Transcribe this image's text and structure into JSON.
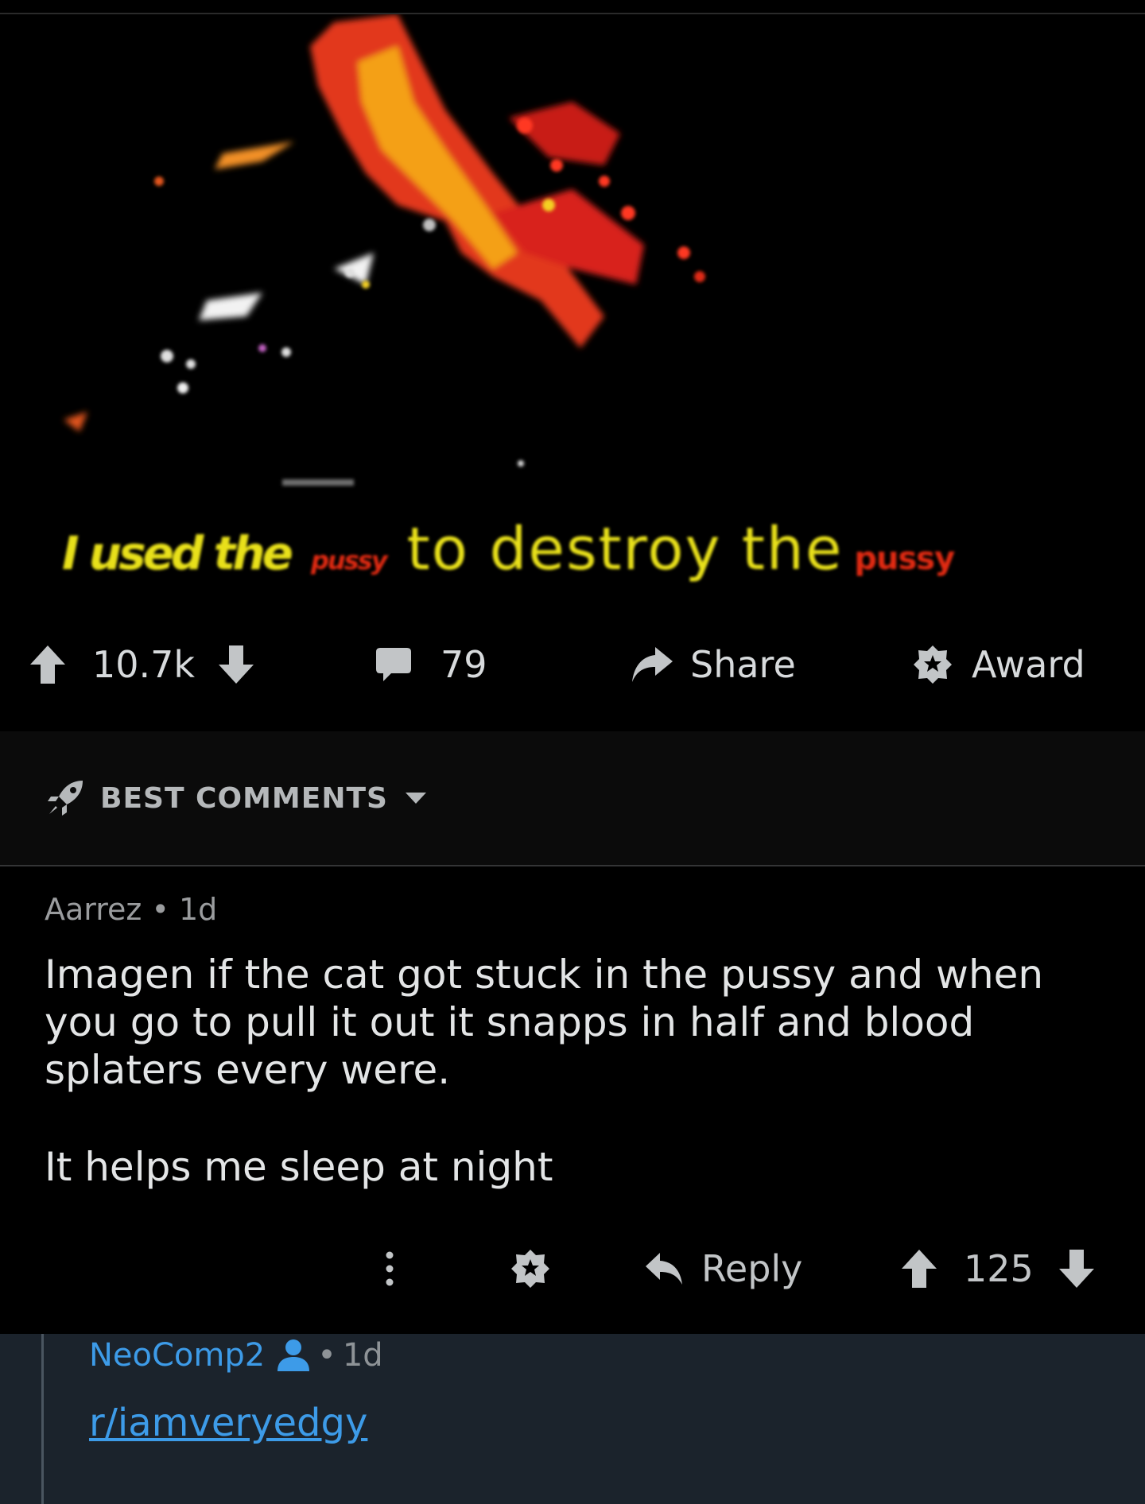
{
  "post": {
    "image_caption": {
      "part1": "I used the",
      "part2": "pussy",
      "part3": "to destroy the",
      "part4": "pussy"
    },
    "votes": "10.7k",
    "comments_count": "79",
    "share_label": "Share",
    "award_label": "Award"
  },
  "sort": {
    "label": "BEST COMMENTS"
  },
  "comment": {
    "author": "Aarrez",
    "separator": "•",
    "time": "1d",
    "body_p1": "Imagen if the cat got stuck in the pussy and when you go to pull it out it snapps in half and blood splaters every were.",
    "body_p2": "It helps me sleep at night",
    "reply_label": "Reply",
    "votes": "125"
  },
  "reply": {
    "author": "NeoComp2",
    "separator": "•",
    "time": "1d",
    "link_text": "r/iamveryedgy"
  },
  "colors": {
    "background": "#000000",
    "accent_blue": "#3d9be8",
    "reply_background": "#1b232c",
    "caption_yellow": "#e8e01a",
    "caption_red": "#e02a12"
  },
  "icons": [
    "upvote-icon",
    "downvote-icon",
    "comment-icon",
    "share-icon",
    "award-icon",
    "rocket-icon",
    "chevron-down-icon",
    "more-options-icon",
    "reply-icon",
    "user-icon"
  ]
}
